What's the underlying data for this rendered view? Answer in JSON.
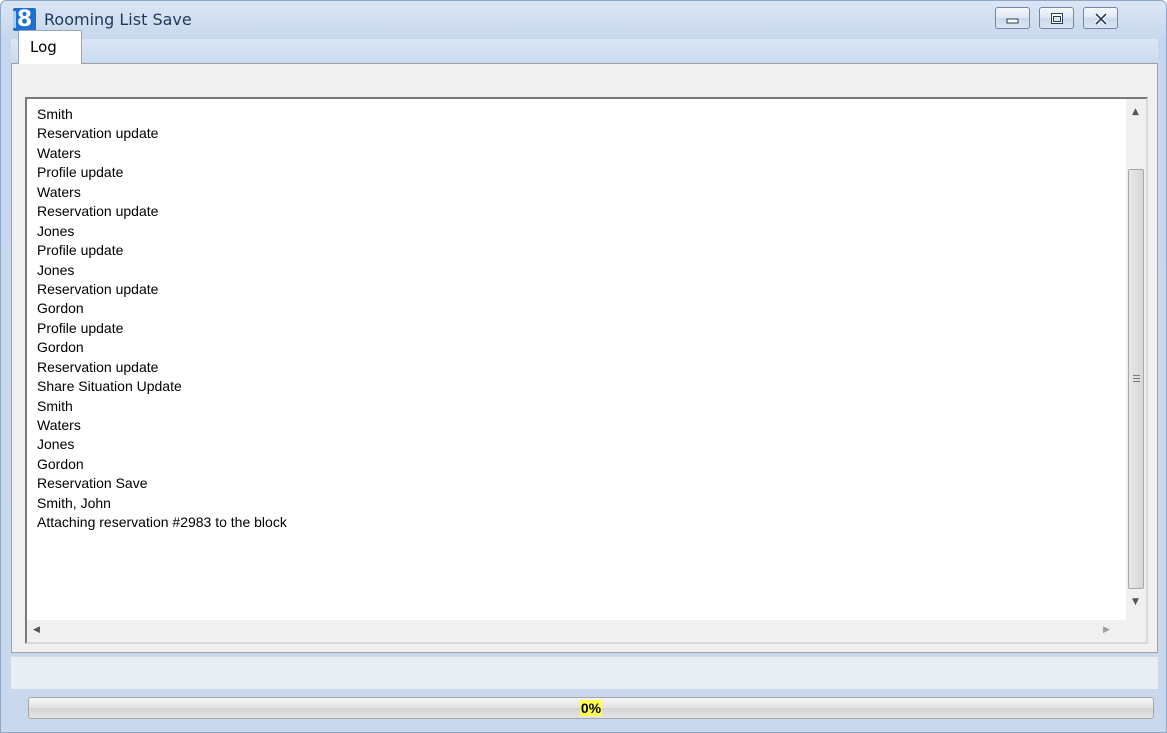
{
  "window": {
    "title": "Rooming List Save",
    "icon": "app-logo-icon",
    "app_logo_glyph": "8",
    "controls": [
      "minimize-icon",
      "maximize-icon",
      "close-icon"
    ]
  },
  "tabs": [
    {
      "label": "Log",
      "active": true
    }
  ],
  "log": {
    "lines": [
      "Smith",
      "Reservation update",
      "Waters",
      "Profile update",
      "Waters",
      "Reservation update",
      "Jones",
      "Profile update",
      "Jones",
      "Reservation update",
      "Gordon",
      "Profile update",
      "Gordon",
      "Reservation update",
      "Share Situation Update",
      "Smith",
      "Waters",
      "Jones",
      "Gordon",
      "Reservation Save",
      "Smith, John",
      "Attaching reservation #2983 to the block"
    ]
  },
  "progress": {
    "value": 0,
    "label": "0%",
    "fill_color": "#2aa12a",
    "label_highlight": "#ffff4d"
  }
}
